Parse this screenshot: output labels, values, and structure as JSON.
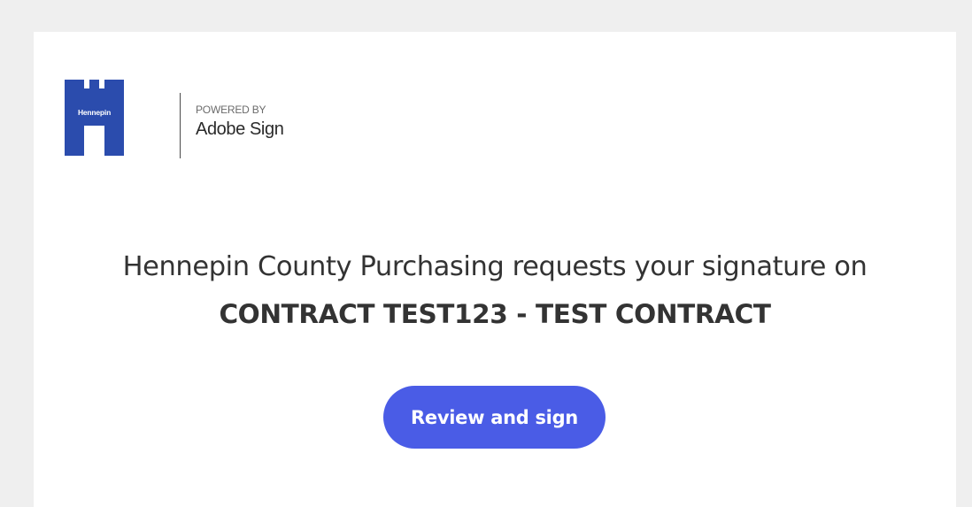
{
  "logo": {
    "org_text": "Hennepin",
    "brand_color": "#2b4cad"
  },
  "powered": {
    "label": "POWERED BY",
    "product": "Adobe Sign"
  },
  "message": {
    "request_text": "Hennepin County Purchasing requests your signature on",
    "document_title": "CONTRACT TEST123 - TEST CONTRACT"
  },
  "actions": {
    "review_label": "Review and sign"
  },
  "colors": {
    "page_bg": "#efefef",
    "card_bg": "#ffffff",
    "button_bg": "#4a5ce6",
    "text": "#333333"
  }
}
